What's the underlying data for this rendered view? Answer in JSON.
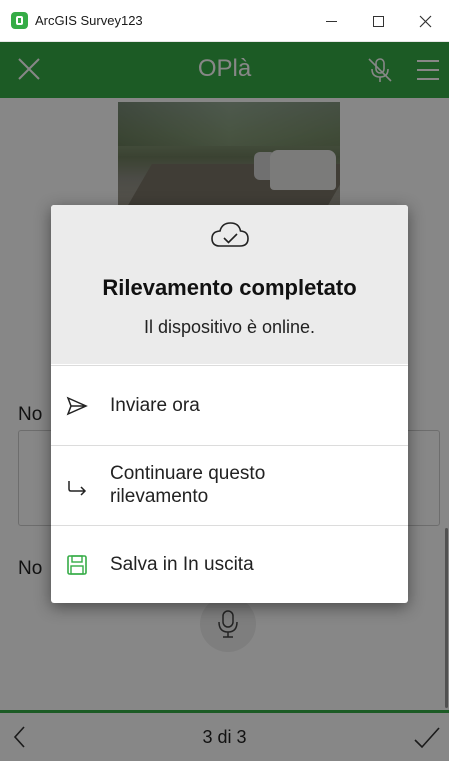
{
  "window": {
    "title": "ArcGIS Survey123",
    "controls": [
      "minimize",
      "maximize",
      "close"
    ]
  },
  "header": {
    "title": "OPlà",
    "left_icon": "close-icon",
    "right_icons": [
      "microphone-off-icon",
      "hamburger-menu-icon"
    ]
  },
  "form": {
    "field1_label": "No",
    "field2_label": "No"
  },
  "footer": {
    "page": "3 di 3",
    "left_icon": "chevron-left-icon",
    "right_icon": "checkmark-icon"
  },
  "dialog": {
    "icon": "cloud-check-icon",
    "title": "Rilevamento completato",
    "subtitle": "Il dispositivo è online.",
    "actions": [
      {
        "label": "Inviare ora",
        "icon": "send-icon"
      },
      {
        "label": "Continuare questo\nrilevamento",
        "icon": "redirect-arrow-icon"
      },
      {
        "label": "Salva in In uscita",
        "icon": "save-disk-icon"
      }
    ]
  },
  "colors": {
    "accent": "#35ac46",
    "overlay": "#000000",
    "dialog_header": "#ebebeb"
  }
}
